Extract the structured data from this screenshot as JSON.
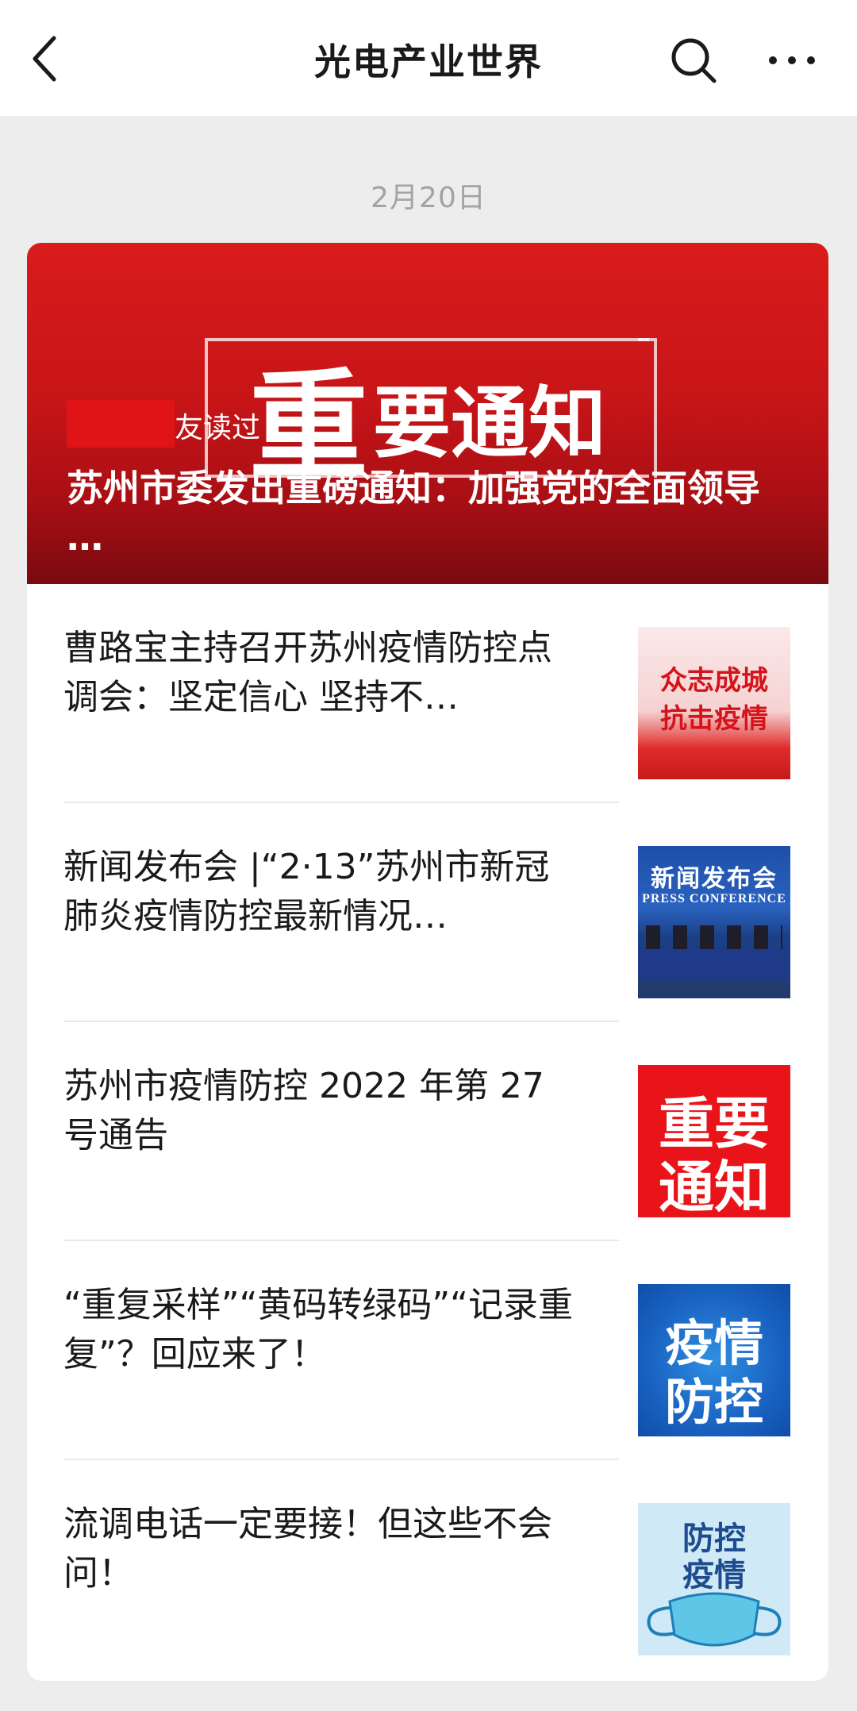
{
  "header": {
    "title": "光电产业世界"
  },
  "date": "2月20日",
  "hero": {
    "banner_big": "重",
    "banner_rest": "要通知",
    "friends_read": "友读过",
    "title": "苏州市委发出重磅通知：加强党的全面领导 …"
  },
  "articles": [
    {
      "title": "曹路宝主持召开苏州疫情防控点调会：坚定信心 坚持不…",
      "thumb_line1": "众志成城",
      "thumb_line2": "抗击疫情"
    },
    {
      "title": "新闻发布会 |“2·13”苏州市新冠肺炎疫情防控最新情况…",
      "thumb_line1": "新闻发布会",
      "thumb_line2": "PRESS CONFERENCE"
    },
    {
      "title": "苏州市疫情防控 2022 年第 27 号通告",
      "thumb_line1": "重要",
      "thumb_line2": "通知"
    },
    {
      "title": "“重复采样”“黄码转绿码”“记录重复”？回应来了！",
      "thumb_line1": "疫情",
      "thumb_line2": "防控"
    },
    {
      "title": "流调电话一定要接！但这些不会问！",
      "thumb_line1": "防控",
      "thumb_line2": "疫情"
    }
  ],
  "colors": {
    "accent_red": "#d91b1b",
    "background": "#ededed",
    "date_gray": "#a3a3a3"
  },
  "icons": {
    "back": "chevron-left-icon",
    "search": "search-icon",
    "more": "more-icon"
  }
}
